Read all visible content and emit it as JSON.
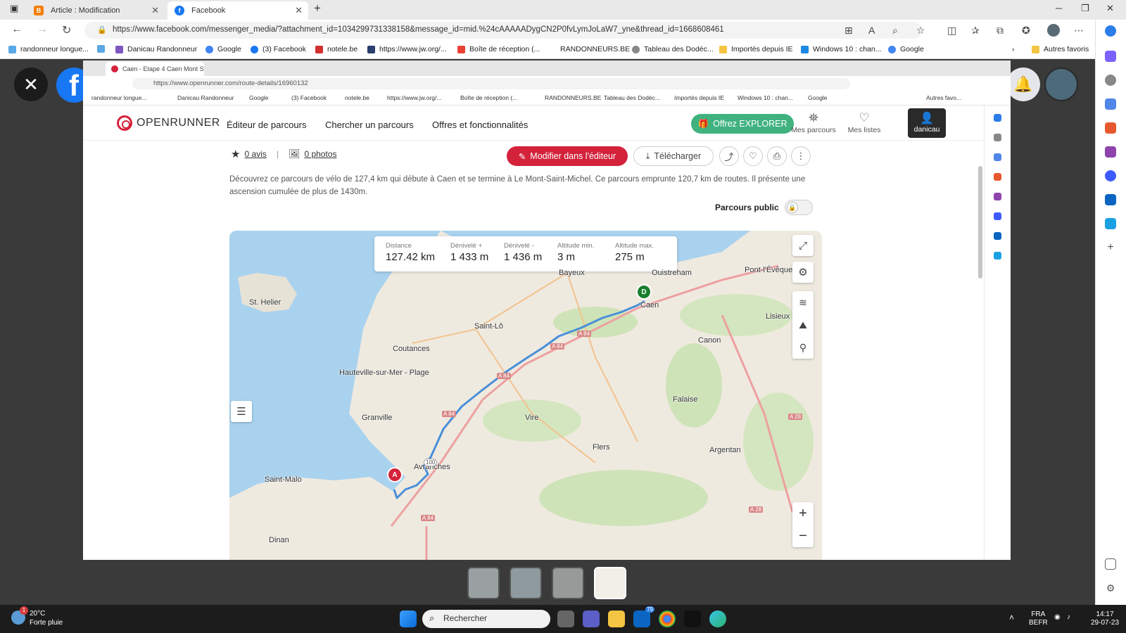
{
  "browser": {
    "tabs": [
      {
        "title": "Article : Modification",
        "icon": "blogger-icon",
        "color": "#f57d00"
      },
      {
        "title": "Facebook",
        "icon": "facebook-icon",
        "color": "#1877f2"
      }
    ],
    "url": "https://www.facebook.com/messenger_media/?attachment_id=1034299731338158&message_id=mid.%24cAAAAADygCN2P0fvLymJoLaW7_yne&thread_id=1668608461",
    "bookmarks": [
      "randonneur longue...",
      "Danicau Randonneur",
      "Google",
      "(3) Facebook",
      "notele.be",
      "https://www.jw.org/...",
      "Boîte de réception (...",
      "RANDONNEURS.BE",
      "Tableau des Dodéc...",
      "Importés depuis IE",
      "Windows 10 : chan...",
      "Google"
    ],
    "other_favorites": "Autres favoris"
  },
  "inner": {
    "tab_title": "Caen - Etape 4 Caen Mont St M...",
    "url": "https://www.openrunner.com/route-details/16960132",
    "bookmarks": [
      "randonneur longue...",
      "Danicau Randonneur",
      "Google",
      "(3) Facebook",
      "notele.be",
      "https://www.jw.org/...",
      "Boîte de réception (...",
      "RANDONNEURS.BE",
      "Tableau des Dodéc...",
      "Importés depuis IE",
      "Windows 10 : chan...",
      "Google",
      "Autres favo..."
    ]
  },
  "openrunner": {
    "logo": "OPENRUNNER",
    "nav": [
      "Éditeur de parcours",
      "Chercher un parcours",
      "Offres et fonctionnalités"
    ],
    "explorer": "Offrez EXPLORER",
    "mes_parcours": "Mes parcours",
    "mes_listes": "Mes listes",
    "user": "danicau",
    "reviews": "0 avis",
    "separator": "|",
    "photos": "0 photos",
    "edit_button": "Modifier dans l'éditeur",
    "download_button": "Télécharger",
    "description": "Découvrez ce parcours de vélo de 127,4 km qui débute à Caen et se termine à Le Mont-Saint-Michel. Ce parcours emprunte 120,7 km de routes. Il présente une ascension cumulée de plus de 1430m.",
    "public_label": "Parcours public"
  },
  "map": {
    "stats": [
      {
        "label": "Distance",
        "value": "127.42 km"
      },
      {
        "label": "Dénivelé +",
        "value": "1 433 m"
      },
      {
        "label": "Dénivelé -",
        "value": "1 436 m"
      },
      {
        "label": "Altitude min.",
        "value": "3 m"
      },
      {
        "label": "Altitude max.",
        "value": "275 m"
      }
    ],
    "places": {
      "bayeux": "Bayeux",
      "ouistreham": "Ouistreham",
      "pont": "Pont-l'Évêque",
      "st_helier": "St. Helier",
      "caen": "Caen",
      "lisieux": "Lisieux",
      "saint_lo": "Saint-Lô",
      "canon": "Canon",
      "coutances": "Coutances",
      "hauteville": "Hauteville-sur-Mer - Plage",
      "falaise": "Falaise",
      "granville": "Granville",
      "vire": "Vire",
      "flers": "Flers",
      "argentan": "Argentan",
      "avranches": "Avranches",
      "saint_malo": "Saint-Malo",
      "dinan": "Dinan"
    },
    "roads": {
      "a84a": "A 84",
      "a84b": "A 84",
      "a84c": "A 84",
      "a84d": "A 84",
      "a84e": "A 84",
      "a28a": "A 28",
      "a28b": "A 28",
      "n100": "100"
    },
    "start_marker": "D",
    "end_marker": "A",
    "zoom_in": "+",
    "zoom_out": "−"
  },
  "taskbar": {
    "temp": "20°C",
    "weather": "Forte pluie",
    "weather_badge": "1",
    "search": "Rechercher",
    "mail_badge": "79",
    "lang1": "FRA",
    "lang2": "BEFR",
    "time": "14:17",
    "date": "29-07-23"
  },
  "colors": {
    "openrunner_red": "#d4223b",
    "explorer_green": "#3fb27f",
    "facebook_blue": "#1877f2",
    "route_blue": "#4a8fd8"
  }
}
